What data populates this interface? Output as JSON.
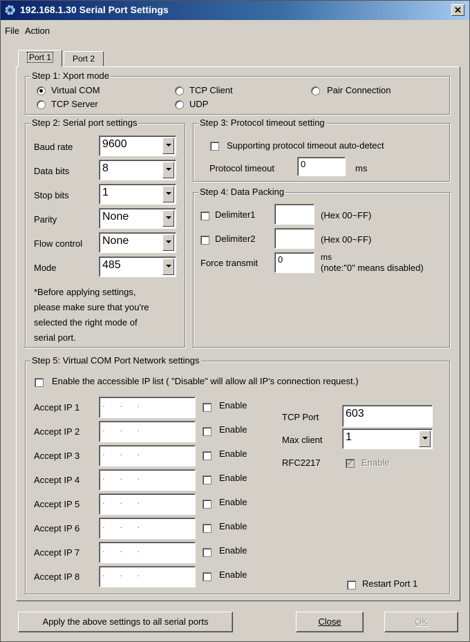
{
  "window": {
    "title": "192.168.1.30 Serial Port Settings"
  },
  "menu": {
    "file": "File",
    "action": "Action"
  },
  "tabs": [
    "Port 1",
    "Port 2"
  ],
  "step1": {
    "title": "Step 1: Xport mode",
    "options": [
      "Virtual COM",
      "TCP Client",
      "Pair Connection",
      "TCP Server",
      "UDP"
    ],
    "selected": "Virtual COM"
  },
  "step2": {
    "title": "Step 2: Serial port settings",
    "fields": [
      {
        "label": "Baud rate",
        "value": "9600"
      },
      {
        "label": "Data bits",
        "value": "8"
      },
      {
        "label": "Stop bits",
        "value": "1"
      },
      {
        "label": "Parity",
        "value": "None"
      },
      {
        "label": "Flow control",
        "value": "None"
      },
      {
        "label": "Mode",
        "value": "485"
      }
    ],
    "note": [
      "*Before applying settings,",
      "please make sure that you're",
      "selected the right mode of",
      "serial port."
    ]
  },
  "step3": {
    "title": "Step 3: Protocol timeout setting",
    "autodetect_label": "Supporting protocol timeout auto-detect",
    "timeout_label": "Protocol timeout",
    "timeout_value": "0",
    "timeout_unit": "ms"
  },
  "step4": {
    "title": "Step 4: Data Packing",
    "delimiter1_label": "Delimiter1",
    "delimiter2_label": "Delimiter2",
    "hex_hint": "(Hex 00~FF)",
    "force_label": "Force transmit",
    "force_value": "0",
    "force_unit": "ms",
    "force_note": "(note:\"0\" means disabled)"
  },
  "step5": {
    "title": "Step 5: Virtual COM Port Network settings",
    "enable_list_label": "Enable the accessible IP list ( \"Disable\" will allow all IP's connection request.)",
    "ip_rows": [
      {
        "label": "Accept IP 1",
        "value": ". . ."
      },
      {
        "label": "Accept IP 2",
        "value": ". . ."
      },
      {
        "label": "Accept IP 3",
        "value": ". . ."
      },
      {
        "label": "Accept IP 4",
        "value": ". . ."
      },
      {
        "label": "Accept IP 5",
        "value": ". . ."
      },
      {
        "label": "Accept IP 6",
        "value": ". . ."
      },
      {
        "label": "Accept IP 7",
        "value": ". . ."
      },
      {
        "label": "Accept IP 8",
        "value": ". . ."
      }
    ],
    "enable_label": "Enable",
    "tcp_port_label": "TCP Port",
    "tcp_port_value": "603",
    "max_client_label": "Max client",
    "max_client_value": "1",
    "rfc_label": "RFC2217",
    "rfc_enable_label": "Enable",
    "restart_label": "Restart Port 1"
  },
  "buttons": {
    "apply_all": "Apply the above settings to all serial ports",
    "close": "Close",
    "ok": "OK"
  }
}
